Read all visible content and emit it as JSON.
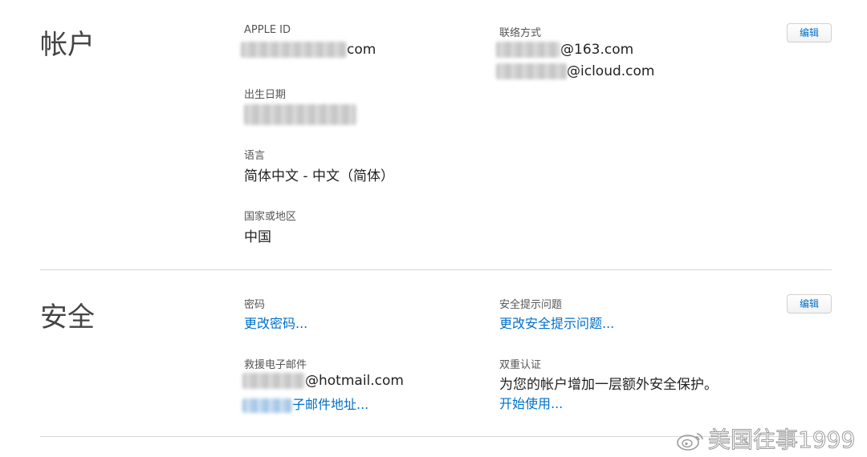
{
  "account": {
    "title": "帐户",
    "apple_id_label": "APPLE ID",
    "apple_id_suffix": "com",
    "birthday_label": "出生日期",
    "language_label": "语言",
    "language_value": "简体中文 - 中文（简体）",
    "region_label": "国家或地区",
    "region_value": "中国",
    "contact_label": "联络方式",
    "contact_email_1_suffix": "@163.com",
    "contact_email_2_suffix": "@icloud.com",
    "edit_label": "编辑"
  },
  "security": {
    "title": "安全",
    "password_label": "密码",
    "password_link": "更改密码...",
    "question_label": "安全提示问题",
    "question_link": "更改安全提示问题...",
    "rescue_label": "救援电子邮件",
    "rescue_email_suffix": "@hotmail.com",
    "rescue_link": "子邮件地址...",
    "twofa_label": "双重认证",
    "twofa_desc": "为您的帐户增加一层额外安全保护。",
    "twofa_link": "开始使用...",
    "edit_label": "编辑"
  },
  "watermark": {
    "text": "美国往事1999",
    "icon": "weibo-logo-icon"
  },
  "colors": {
    "link": "#0070c9",
    "divider": "#d8d8d8"
  }
}
